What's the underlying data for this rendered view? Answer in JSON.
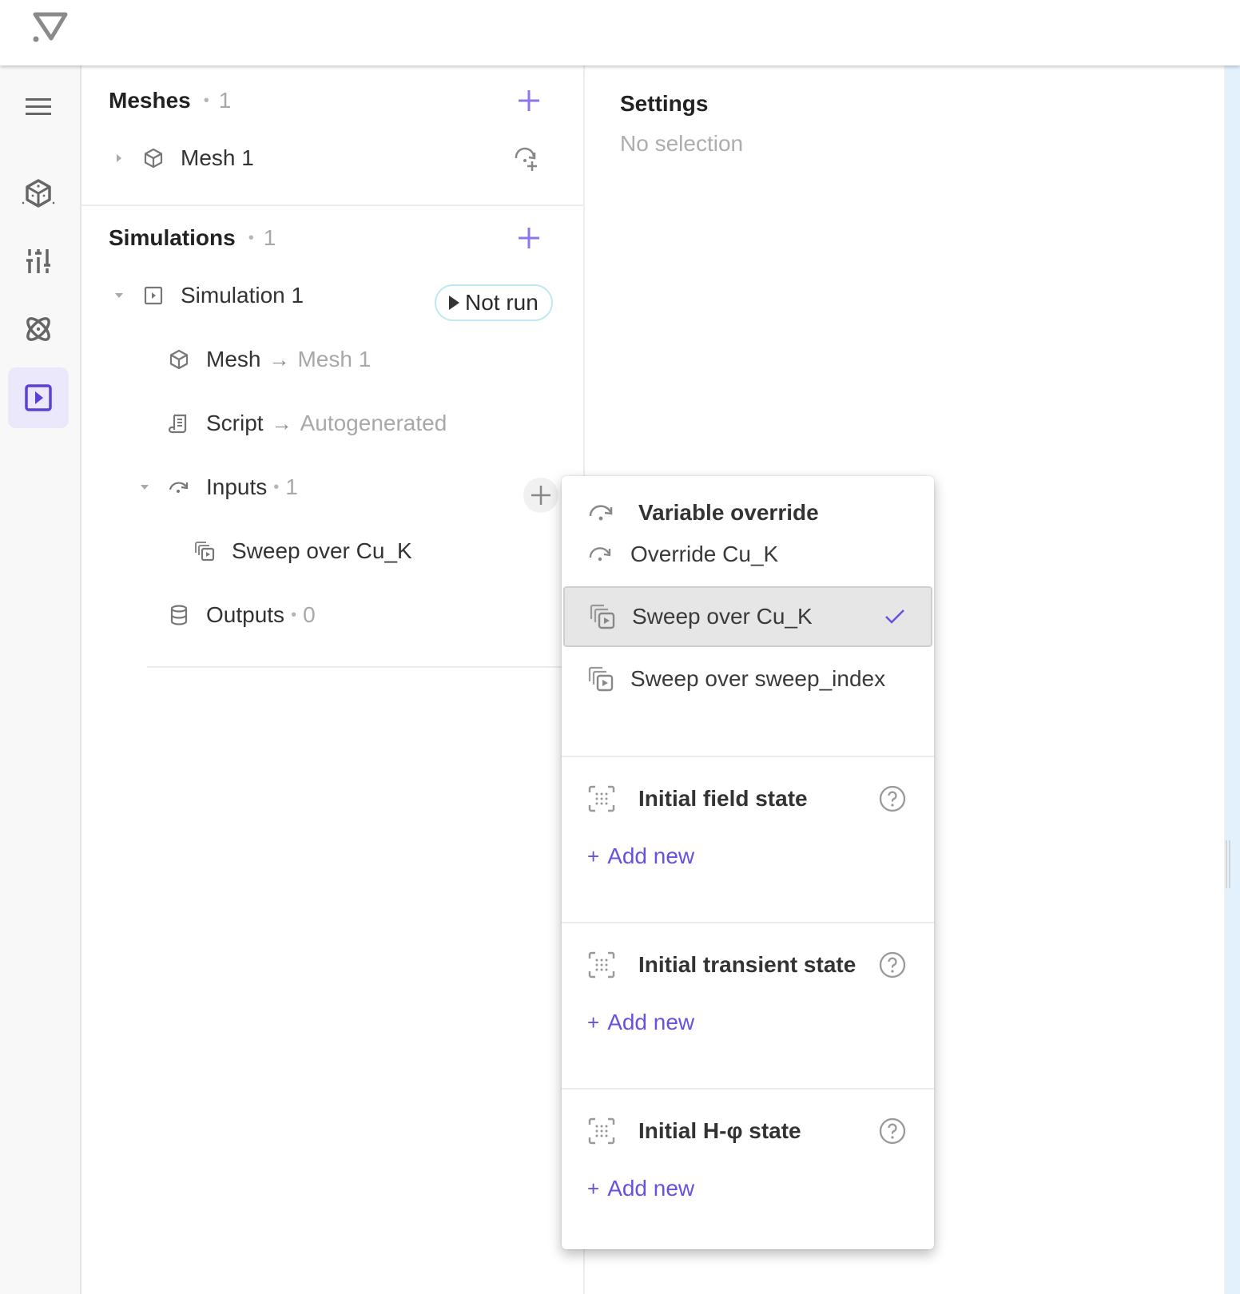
{
  "app": {
    "logo_icon": "app-logo-icon"
  },
  "rail": {
    "items": [
      {
        "name": "menu",
        "icon": "hamburger-icon",
        "active": false
      },
      {
        "name": "geometry",
        "icon": "cube-icon",
        "active": false
      },
      {
        "name": "parameters",
        "icon": "sliders-icon",
        "active": false
      },
      {
        "name": "physics",
        "icon": "atom-icon",
        "active": false
      },
      {
        "name": "simulations",
        "icon": "play-square-icon",
        "active": true
      }
    ]
  },
  "tree": {
    "meshes": {
      "title": "Meshes",
      "count": "1",
      "items": [
        {
          "label": "Mesh 1",
          "icon": "cube-outline-icon",
          "action_icon": "override-add-icon"
        }
      ]
    },
    "simulations": {
      "title": "Simulations",
      "count": "1",
      "items": [
        {
          "label": "Simulation 1",
          "status": "Not run",
          "children": {
            "mesh": {
              "label": "Mesh",
              "arrow": "→",
              "value": "Mesh 1"
            },
            "script": {
              "label": "Script",
              "arrow": "→",
              "value": "Autogenerated"
            },
            "inputs": {
              "label": "Inputs",
              "count": "1",
              "items": [
                {
                  "label": "Sweep over Cu_K"
                }
              ]
            },
            "outputs": {
              "label": "Outputs",
              "count": "0"
            }
          }
        }
      ]
    }
  },
  "settings": {
    "title": "Settings",
    "subtitle": "No selection"
  },
  "dropdown": {
    "variable_override": {
      "title": "Variable override",
      "items": [
        {
          "label": "Override Cu_K",
          "icon": "override-icon",
          "selected": false
        },
        {
          "label": "Sweep over Cu_K",
          "icon": "sweep-icon",
          "selected": true
        },
        {
          "label": "Sweep over sweep_index",
          "icon": "sweep-icon",
          "selected": false
        }
      ]
    },
    "groups": [
      {
        "title": "Initial field state",
        "add_label": "Add new"
      },
      {
        "title": "Initial transient state",
        "add_label": "Add new"
      },
      {
        "title": "Initial H-φ state",
        "add_label": "Add new"
      }
    ],
    "add_prefix": "+"
  },
  "colors": {
    "accent": "#6a4fe0",
    "active_rail_bg": "#ebe8fb",
    "status_border": "#bfe9ef"
  }
}
